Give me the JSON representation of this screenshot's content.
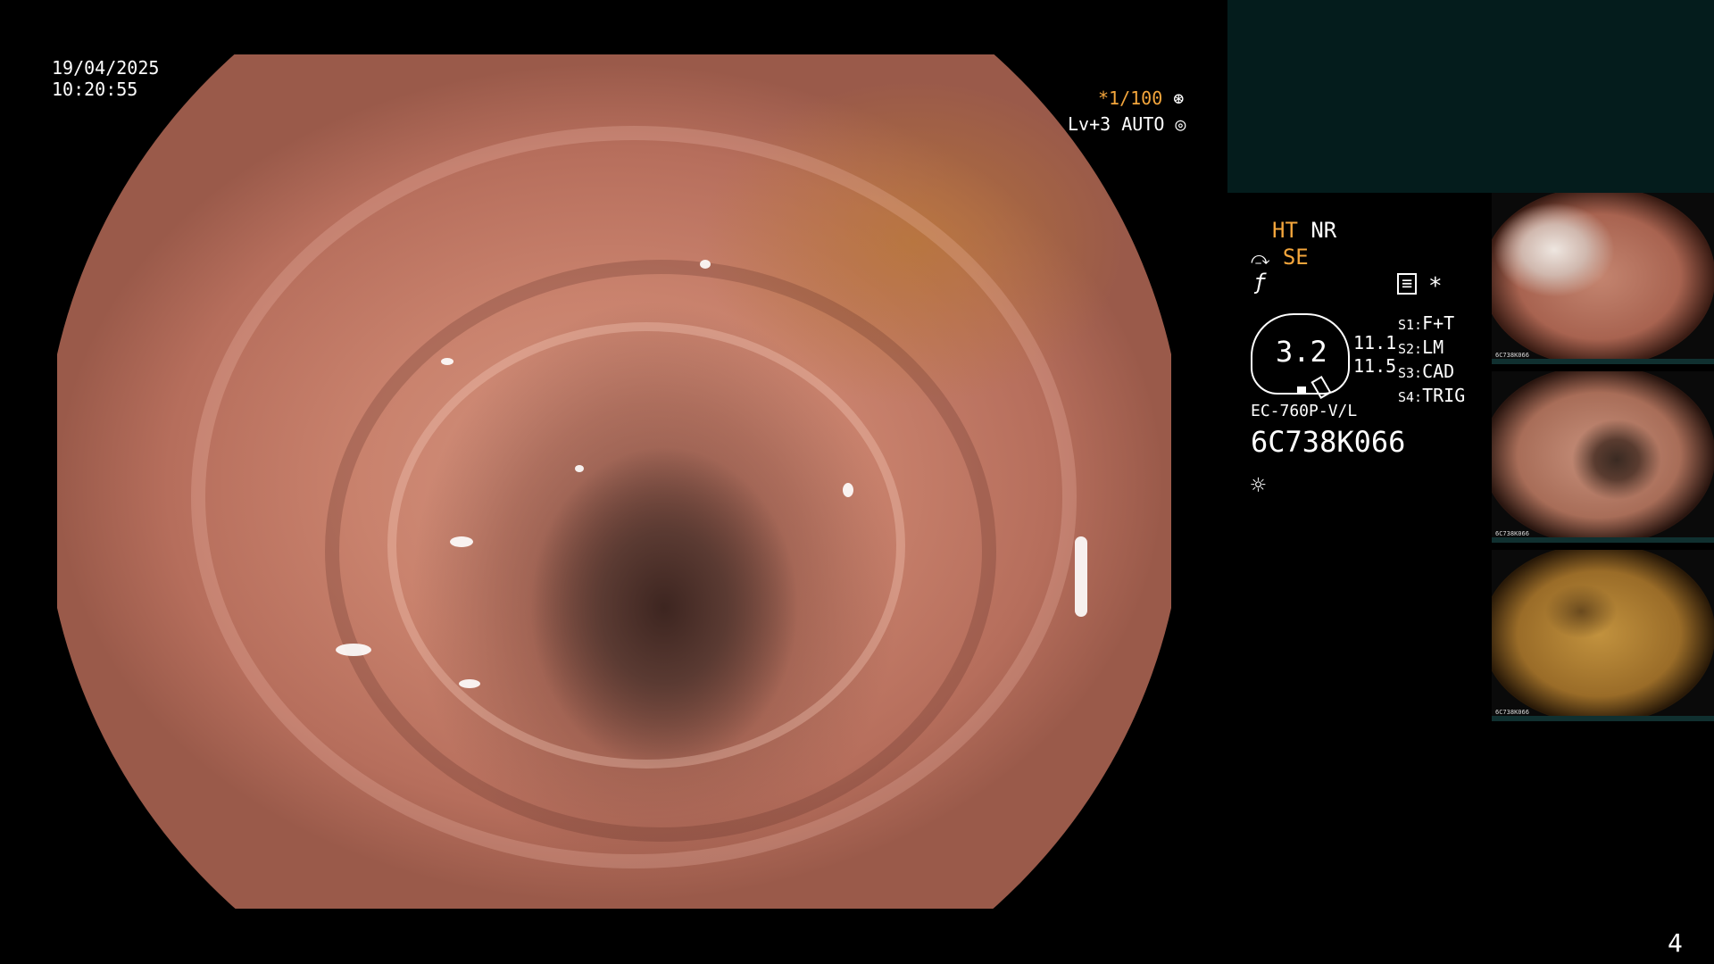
{
  "overlay": {
    "date": "19/04/2025",
    "time": "10:20:55",
    "shutter": "*1/100",
    "level": "Lv+3 AUTO",
    "page_number": "4"
  },
  "panel": {
    "ht": "HT",
    "nr": "NR",
    "se": "SE",
    "asterisk": "*",
    "gauge_value": "3.2",
    "val1": "11.1",
    "val2": "11.5",
    "switches": [
      {
        "key": "S1:",
        "value": "F+T"
      },
      {
        "key": "S2:",
        "value": "LM"
      },
      {
        "key": "S3:",
        "value": "CAD"
      },
      {
        "key": "S4:",
        "value": "TRIG"
      }
    ],
    "model": "EC-760P-V/L",
    "serial": "6C738K066"
  },
  "thumbnails": [
    {
      "label": "6C738K066",
      "tone": "#c48570",
      "lumen": "#e8ddd6"
    },
    {
      "label": "6C738K066",
      "tone": "#b57d68",
      "lumen": "#5a3c30"
    },
    {
      "label": "6C738K066",
      "tone": "#b78a3e",
      "lumen": "#7a5a24"
    }
  ],
  "colors": {
    "accent_orange": "#f4a63c",
    "background": "#000000",
    "panel_box": "#041c1c"
  }
}
